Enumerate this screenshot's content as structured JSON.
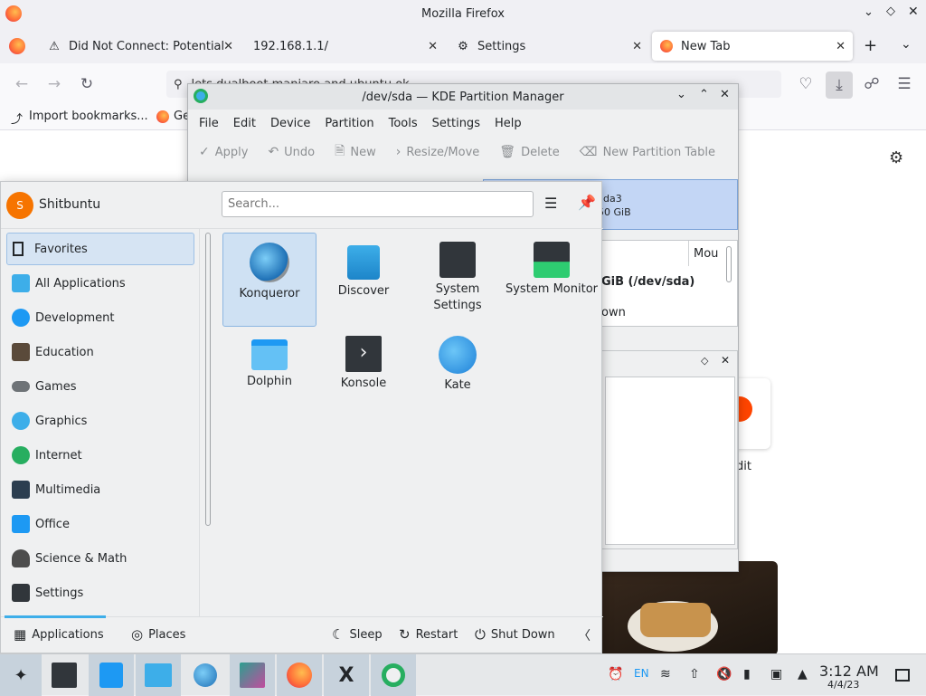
{
  "firefox": {
    "window_title": "Mozilla Firefox",
    "tabs": [
      {
        "label": "Did Not Connect: Potential",
        "icon": "warning-icon"
      },
      {
        "label": "192.168.1.1/",
        "icon": ""
      },
      {
        "label": "Settings",
        "icon": "gear-icon"
      },
      {
        "label": "New Tab",
        "icon": "firefox-icon",
        "active": true
      }
    ],
    "url_text": "lets dualboot manjaro and ubuntu ok",
    "bookmarks": [
      {
        "label": "Import bookmarks..."
      },
      {
        "label": "Ge"
      }
    ],
    "shortcut_label": "dit"
  },
  "pm": {
    "title": "/dev/sda — KDE Partition Manager",
    "menu": [
      "File",
      "Edit",
      "Device",
      "Partition",
      "Tools",
      "Settings",
      "Help"
    ],
    "toolbar": {
      "apply": "Apply",
      "undo": "Undo",
      "new": "New",
      "resize": "Resize/Move",
      "delete": "Delete",
      "new_table": "New Partition Table"
    },
    "bar_label": "da3",
    "bar_size": "50 GiB",
    "col_header": "Mou",
    "row1": "GiB (/dev/sda)",
    "row2": "own"
  },
  "launcher": {
    "user": "Shitbuntu",
    "avatar_letter": "S",
    "search_placeholder": "Search...",
    "categories": [
      {
        "label": "Favorites",
        "color": "#ffffff"
      },
      {
        "label": "All Applications",
        "color": "#3daee9"
      },
      {
        "label": "Development",
        "color": "#1d99f3"
      },
      {
        "label": "Education",
        "color": "#5a4a3a"
      },
      {
        "label": "Games",
        "color": "#6e7377"
      },
      {
        "label": "Graphics",
        "color": "#3daee9"
      },
      {
        "label": "Internet",
        "color": "#27ae60"
      },
      {
        "label": "Multimedia",
        "color": "#2c3e50"
      },
      {
        "label": "Office",
        "color": "#1d99f3"
      },
      {
        "label": "Science & Math",
        "color": "#4d4d4d"
      },
      {
        "label": "Settings",
        "color": "#31363b"
      }
    ],
    "apps": [
      {
        "label": "Konqueror",
        "icon": "konqueror-icon"
      },
      {
        "label": "Discover",
        "icon": "discover-icon"
      },
      {
        "label": "System Settings",
        "icon": "system-settings-icon"
      },
      {
        "label": "System Monitor",
        "icon": "system-monitor-icon"
      },
      {
        "label": "Dolphin",
        "icon": "dolphin-icon"
      },
      {
        "label": "Konsole",
        "icon": "konsole-icon"
      },
      {
        "label": "Kate",
        "icon": "kate-icon"
      }
    ],
    "footer": {
      "applications": "Applications",
      "places": "Places",
      "sleep": "Sleep",
      "restart": "Restart",
      "shutdown": "Shut Down"
    }
  },
  "taskbar": {
    "lang": "EN",
    "time": "3:12 AM",
    "date": "4/4/23"
  }
}
